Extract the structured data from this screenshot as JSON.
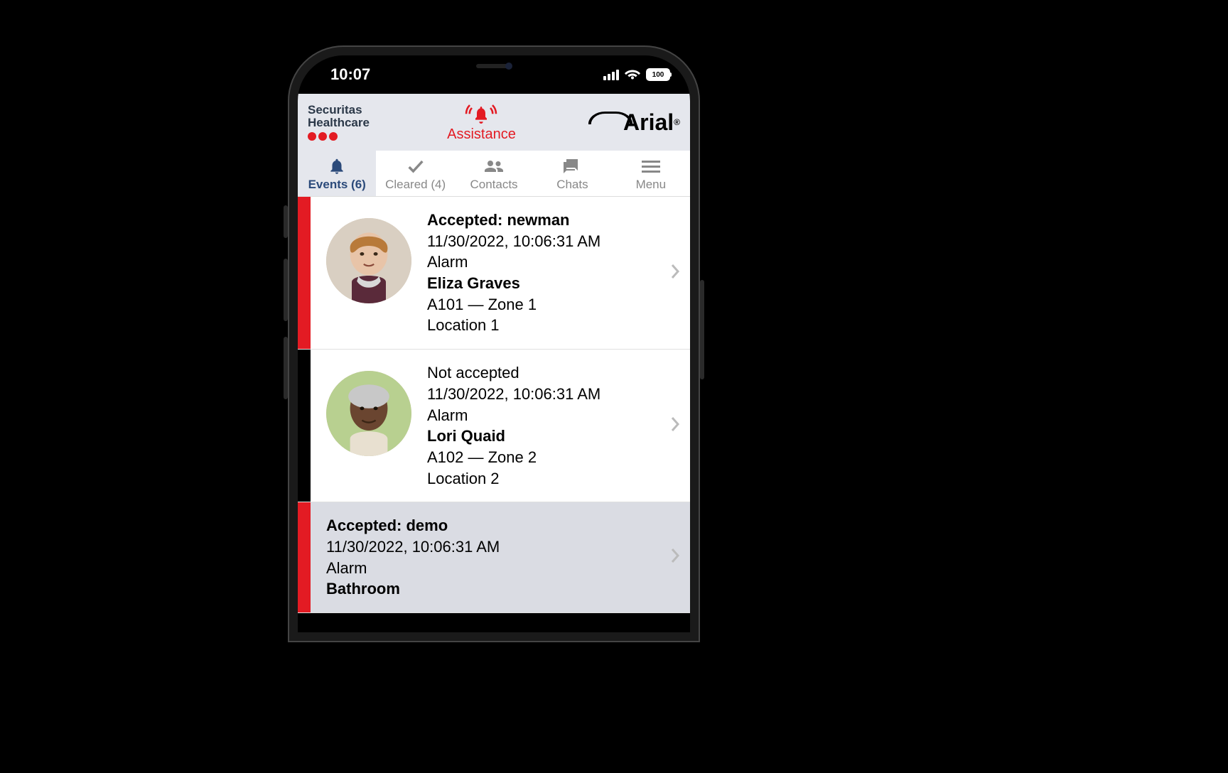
{
  "status_bar": {
    "time": "10:07",
    "battery": "100"
  },
  "header": {
    "brand_line1": "Securitas",
    "brand_line2": "Healthcare",
    "assistance_label": "Assistance",
    "right_brand": "Arial"
  },
  "tabs": [
    {
      "label": "Events (6)",
      "icon": "bell",
      "active": true
    },
    {
      "label": "Cleared (4)",
      "icon": "check",
      "active": false
    },
    {
      "label": "Contacts",
      "icon": "people",
      "active": false
    },
    {
      "label": "Chats",
      "icon": "chat",
      "active": false
    },
    {
      "label": "Menu",
      "icon": "menu",
      "active": false
    }
  ],
  "events": [
    {
      "priority_color": "red",
      "status": "Accepted: newman",
      "timestamp": "11/30/2022, 10:06:31 AM",
      "type": "Alarm",
      "name": "Eliza Graves",
      "room_zone": "A101 — Zone 1",
      "location": "Location 1",
      "avatar_tone": "light"
    },
    {
      "priority_color": "black",
      "status": "Not accepted",
      "timestamp": "11/30/2022, 10:06:31 AM",
      "type": "Alarm",
      "name": "Lori Quaid",
      "room_zone": "A102 — Zone 2",
      "location": "Location 2",
      "avatar_tone": "dark"
    },
    {
      "priority_color": "red",
      "status": "Accepted: demo",
      "timestamp": "11/30/2022, 10:06:31 AM",
      "type": "Alarm",
      "name": "Bathroom",
      "room_zone": "",
      "location": "",
      "selected": true,
      "no_avatar": true
    }
  ]
}
